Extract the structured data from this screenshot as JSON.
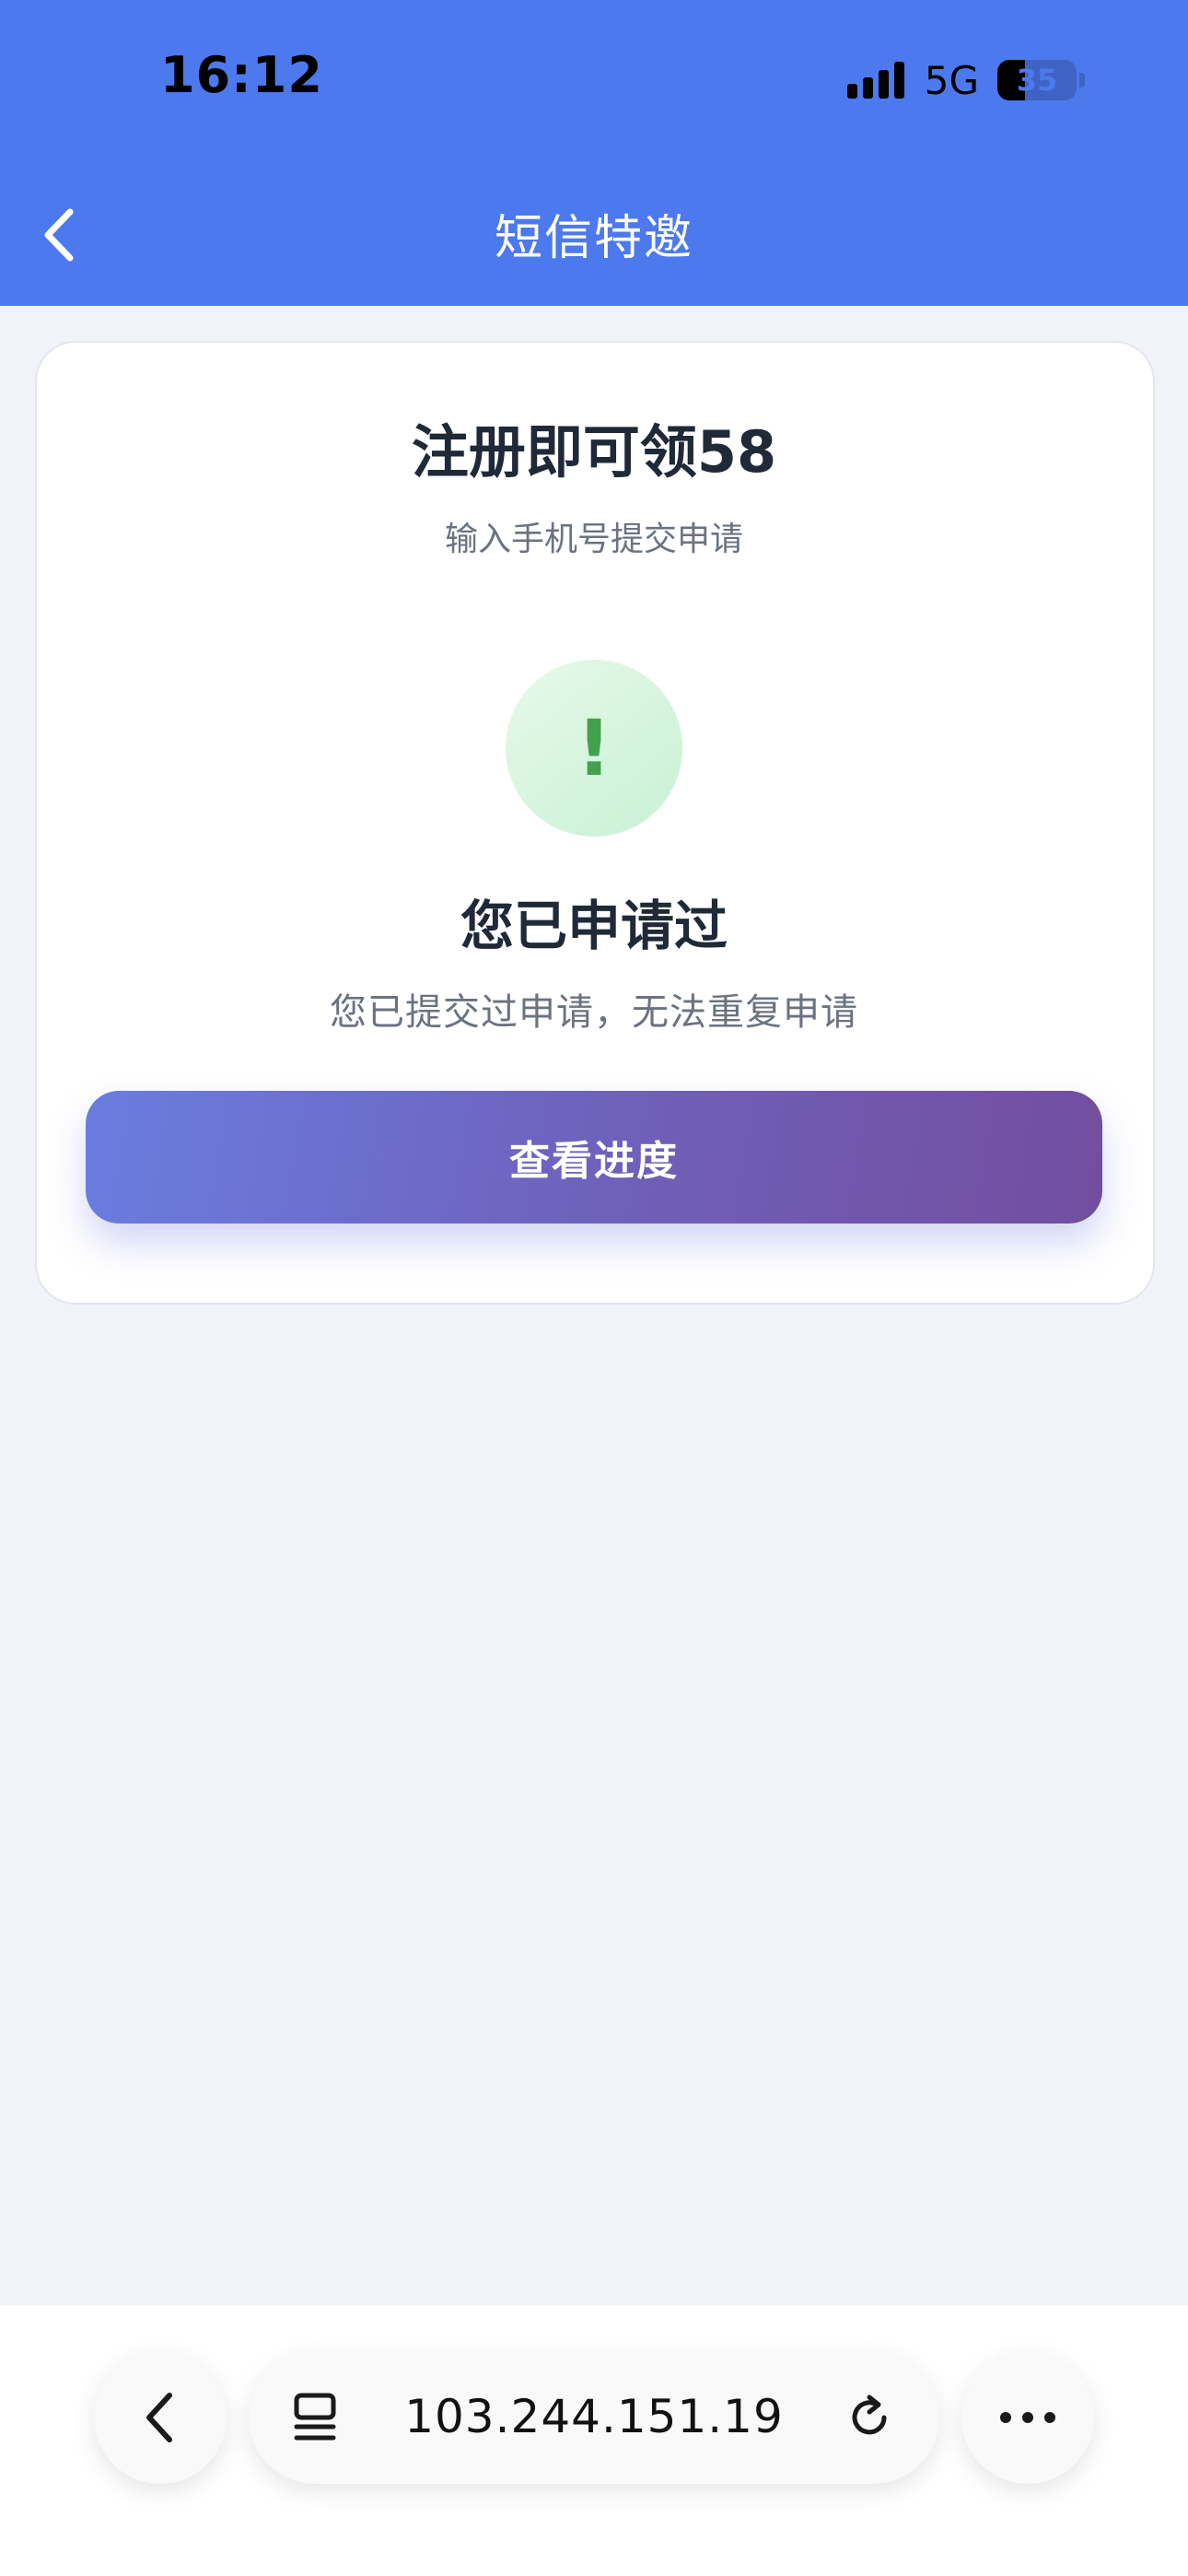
{
  "status_bar": {
    "time": "16:12",
    "network": "5G",
    "battery_level": "35"
  },
  "nav": {
    "title": "短信特邀",
    "back_icon": "chevron-left-icon"
  },
  "card": {
    "title": "注册即可领58",
    "subtitle": "输入手机号提交申请",
    "status_icon_glyph": "!",
    "status_title": "您已申请过",
    "status_desc": "您已提交过申请，无法重复申请",
    "button_label": "查看进度"
  },
  "browser": {
    "url": "103.244.151.19",
    "back_icon": "chevron-left-icon",
    "tabs_icon": "tabs-icon",
    "reload_icon": "reload-icon",
    "more_icon": "more-icon"
  },
  "colors": {
    "header": "#4d79ee",
    "accent_green": "#43a04f",
    "button_start": "#6a7de0",
    "button_end": "#734e9f"
  }
}
